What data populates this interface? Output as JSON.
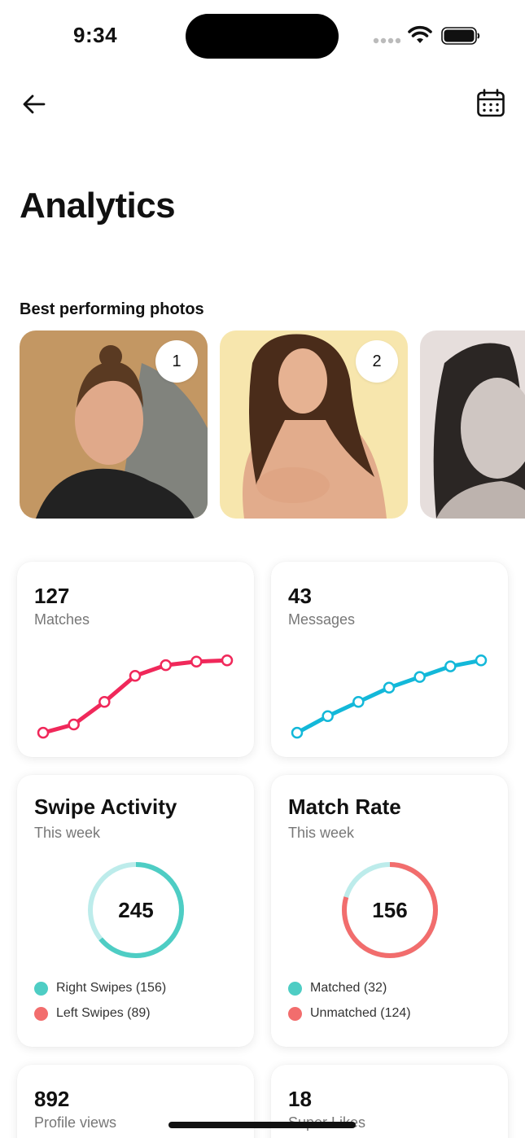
{
  "status_bar": {
    "time": "9:34"
  },
  "header": {
    "title": "Analytics"
  },
  "best_photos": {
    "title": "Best performing photos",
    "photos": [
      {
        "rank": "1"
      },
      {
        "rank": "2"
      },
      {
        "rank": ""
      }
    ]
  },
  "stats": {
    "matches": {
      "value": "127",
      "label": "Matches",
      "trend": [
        4,
        11,
        30,
        52,
        61,
        64,
        65
      ],
      "color": "#f0285a"
    },
    "messages": {
      "value": "43",
      "label": "Messages",
      "trend": [
        4,
        18,
        30,
        42,
        51,
        60,
        65
      ],
      "color": "#13b8d9"
    }
  },
  "swipe_activity": {
    "title": "Swipe Activity",
    "subtitle": "This week",
    "total": "245",
    "legend": [
      {
        "label": "Right Swipes (156)",
        "value": 156,
        "color": "#4ecdc4"
      },
      {
        "label": "Left Swipes (89)",
        "value": 89,
        "color": "#f26d6d"
      }
    ],
    "donut": {
      "primary_fraction": 0.64,
      "primary_color": "#4ecdc4",
      "track_color": "#bdeceb"
    }
  },
  "match_rate": {
    "title": "Match Rate",
    "subtitle": "This week",
    "total": "156",
    "legend": [
      {
        "label": "Matched (32)",
        "value": 32,
        "color": "#4ecdc4"
      },
      {
        "label": "Unmatched (124)",
        "value": 124,
        "color": "#f26d6d"
      }
    ],
    "donut": {
      "primary_fraction": 0.795,
      "primary_color": "#f26d6d",
      "track_color": "#bdeceb"
    }
  },
  "bottom_stats": {
    "profile_views": {
      "value": "892",
      "label": "Profile views"
    },
    "super_likes": {
      "value": "18",
      "label": "Super Likes"
    }
  },
  "colors": {
    "teal": "#4ecdc4",
    "coral": "#f26d6d",
    "pink": "#f0285a",
    "cyan": "#13b8d9"
  }
}
